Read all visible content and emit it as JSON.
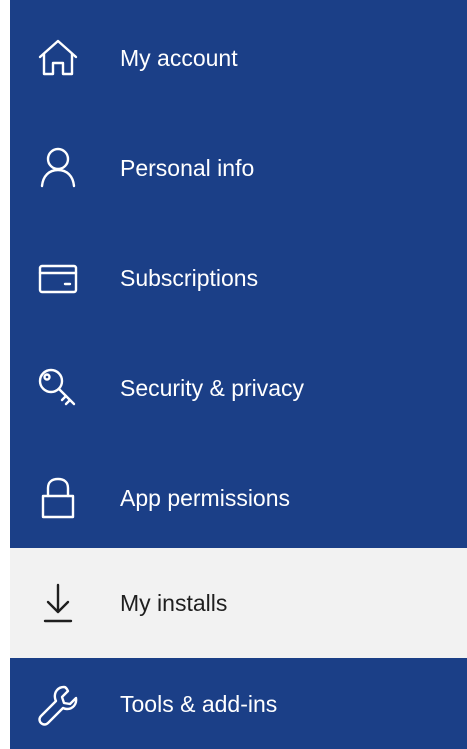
{
  "nav": {
    "items": [
      {
        "label": "My account",
        "icon": "home-icon"
      },
      {
        "label": "Personal info",
        "icon": "person-icon"
      },
      {
        "label": "Subscriptions",
        "icon": "card-icon"
      },
      {
        "label": "Security & privacy",
        "icon": "key-icon"
      },
      {
        "label": "App permissions",
        "icon": "lock-icon"
      },
      {
        "label": "My installs",
        "icon": "download-icon",
        "active": true
      },
      {
        "label": "Tools & add-ins",
        "icon": "wrench-icon"
      }
    ]
  },
  "colors": {
    "nav_background": "#1b3f87",
    "active_background": "#f2f2f2",
    "text_light": "#ffffff",
    "text_dark": "#1f1f1f"
  }
}
